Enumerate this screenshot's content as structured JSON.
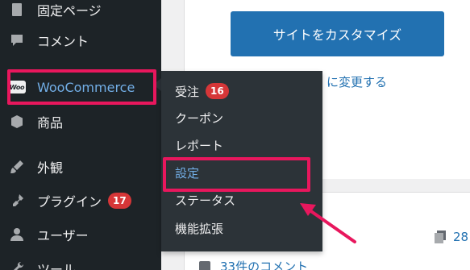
{
  "sidebar": {
    "items": [
      {
        "label": "固定ページ",
        "icon": "pages-icon"
      },
      {
        "label": "コメント",
        "icon": "comment-icon"
      },
      {
        "label": "WooCommerce",
        "icon": "woocommerce-logo-icon",
        "active_hover": true
      },
      {
        "label": "商品",
        "icon": "box-icon"
      },
      {
        "label": "外観",
        "icon": "paintbrush-icon"
      },
      {
        "label": "プラグイン",
        "icon": "plugin-icon",
        "badge": "17"
      },
      {
        "label": "ユーザー",
        "icon": "user-icon"
      },
      {
        "label": "ツール",
        "icon": "wrench-icon"
      }
    ],
    "woo_logo_text": "Woo"
  },
  "submenu": {
    "items": [
      {
        "label": "受注",
        "badge": "16"
      },
      {
        "label": "クーポン"
      },
      {
        "label": "レポート"
      },
      {
        "label": "設定",
        "current": true
      },
      {
        "label": "ステータス"
      },
      {
        "label": "機能拡張"
      }
    ]
  },
  "main": {
    "customize_button": "サイトをカスタマイズ",
    "change_link": "に変更する",
    "page_count": "28",
    "comment_link": "33件のコメント"
  },
  "colors": {
    "sidebar_bg": "#1d2327",
    "submenu_bg": "#2c3338",
    "accent_blue": "#2271b1",
    "link_blue": "#72aee6",
    "badge_red": "#d63638",
    "highlight_pink": "#e8175d"
  }
}
